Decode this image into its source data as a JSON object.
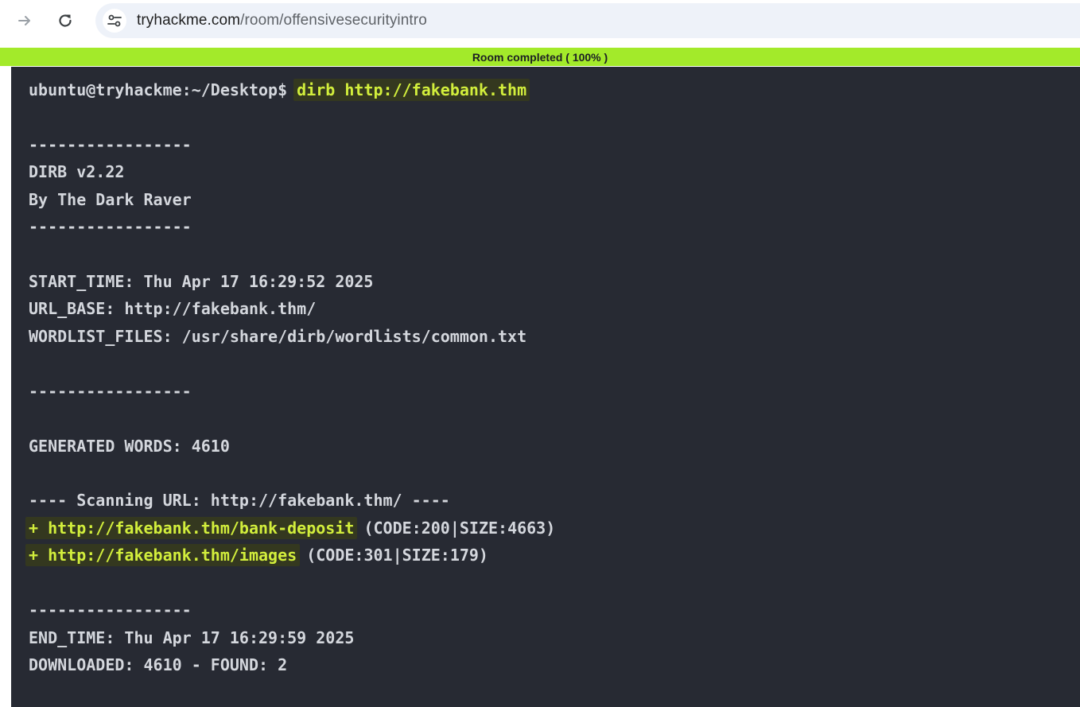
{
  "browser": {
    "url_host": "tryhackme.com",
    "url_path": "/room/offensivesecurityintro",
    "icons": {
      "forward": "arrow-right-icon",
      "reload": "reload-icon",
      "site_info": "tune-icon"
    }
  },
  "progress": {
    "label": "Room completed ( 100% )",
    "value_percent": 100,
    "color": "#a3ea2a"
  },
  "terminal": {
    "background": "#272a33",
    "highlight_color": "#d2ee3c",
    "prompt": "ubuntu@tryhackme:~/Desktop$",
    "command": "dirb http://fakebank.thm",
    "separator": "-----------------",
    "banner_name": "DIRB v2.22",
    "banner_author": "By The Dark Raver",
    "start_time": "START_TIME: Thu Apr 17 16:29:52 2025",
    "url_base": "URL_BASE: http://fakebank.thm/",
    "wordlist": "WORDLIST_FILES: /usr/share/dirb/wordlists/common.txt",
    "generated_words": "GENERATED WORDS: 4610",
    "scanning": "---- Scanning URL: http://fakebank.thm/ ----",
    "results": [
      {
        "url": "+ http://fakebank.thm/bank-deposit",
        "info": " (CODE:200|SIZE:4663)"
      },
      {
        "url": "+ http://fakebank.thm/images",
        "info": " (CODE:301|SIZE:179)"
      }
    ],
    "end_time": "END_TIME: Thu Apr 17 16:29:59 2025",
    "downloaded": "DOWNLOADED: 4610 - FOUND: 2"
  }
}
